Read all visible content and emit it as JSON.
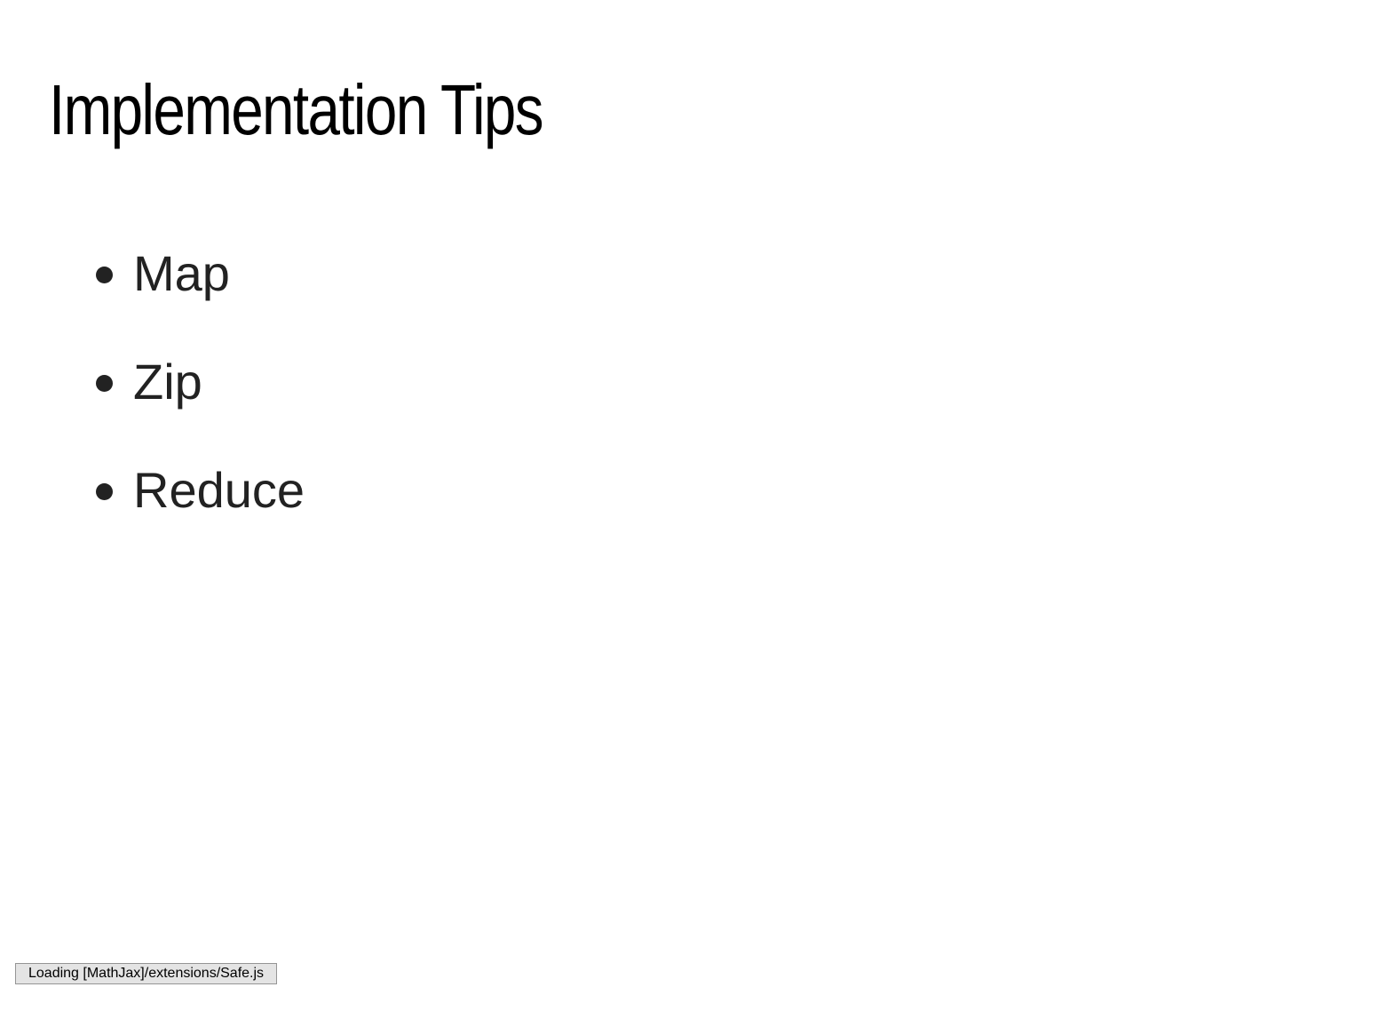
{
  "slide": {
    "title": "Implementation Tips",
    "bullets": [
      {
        "label": "Map"
      },
      {
        "label": "Zip"
      },
      {
        "label": "Reduce"
      }
    ]
  },
  "status": {
    "message": "Loading [MathJax]/extensions/Safe.js"
  },
  "colors": {
    "background": "#ffffff",
    "title_text": "#000000",
    "body_text": "#222222",
    "status_background": "#e4e4e4",
    "status_border": "#959595"
  }
}
